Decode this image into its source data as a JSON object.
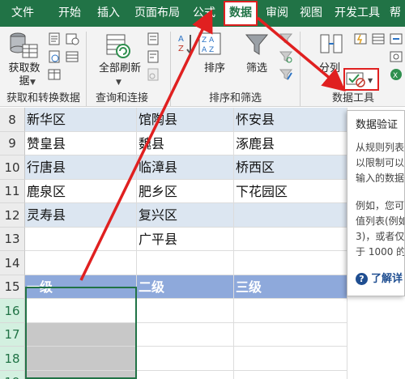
{
  "menu": {
    "tabs": [
      {
        "label": "文件"
      },
      {
        "label": "开始"
      },
      {
        "label": "插入"
      },
      {
        "label": "页面布局"
      },
      {
        "label": "公式"
      },
      {
        "label": "数据"
      },
      {
        "label": "审阅"
      },
      {
        "label": "视图"
      },
      {
        "label": "开发工具"
      },
      {
        "label": "帮"
      }
    ],
    "active_tab": "数据"
  },
  "ribbon": {
    "get_data_label": "获取数\n据",
    "refresh_all_label": "全部刷新",
    "sort_label": "排序",
    "filter_label": "筛选",
    "split_label": "分列",
    "groups": [
      {
        "label": "获取和转换数据"
      },
      {
        "label": "查询和连接"
      },
      {
        "label": "排序和筛选"
      },
      {
        "label": "数据工具"
      }
    ]
  },
  "grid": {
    "rows": [
      {
        "num": "8",
        "cells": [
          "新华区",
          "馆陶县",
          "怀安县"
        ],
        "band": "blue"
      },
      {
        "num": "9",
        "cells": [
          "赞皇县",
          "魏县",
          "涿鹿县"
        ],
        "band": "white"
      },
      {
        "num": "10",
        "cells": [
          "行唐县",
          "临漳县",
          "桥西区"
        ],
        "band": "blue"
      },
      {
        "num": "11",
        "cells": [
          "鹿泉区",
          "肥乡区",
          "下花园区"
        ],
        "band": "white"
      },
      {
        "num": "12",
        "cells": [
          "灵寿县",
          "复兴区",
          ""
        ],
        "band": "blue"
      },
      {
        "num": "13",
        "cells": [
          "",
          "广平县",
          ""
        ],
        "band": "white"
      },
      {
        "num": "14",
        "cells": [
          "",
          "",
          ""
        ],
        "band": "white"
      },
      {
        "num": "15",
        "cells": [
          "一级",
          "二级",
          "三级"
        ],
        "band": "header"
      },
      {
        "num": "16",
        "cells": [
          "",
          "",
          ""
        ],
        "band": "white"
      },
      {
        "num": "17",
        "cells": [
          "",
          "",
          ""
        ],
        "band": "white"
      },
      {
        "num": "18",
        "cells": [
          "",
          "",
          ""
        ],
        "band": "white"
      },
      {
        "num": "19",
        "cells": [
          "",
          "",
          ""
        ],
        "band": "white"
      }
    ]
  },
  "tooltip": {
    "title": "数据验证",
    "para1": [
      "从规则列表",
      "以限制可以",
      "输入的数据"
    ],
    "para2": [
      "例如，您可",
      "值列表(例如",
      "3)，或者仅",
      "于 1000 的"
    ],
    "learn_more": "了解详"
  },
  "colors": {
    "accent": "#217346",
    "highlight": "#e02020",
    "band_blue": "#dce6f1",
    "header_blue": "#8ea9db",
    "selection_gray": "#c8c8c8"
  }
}
